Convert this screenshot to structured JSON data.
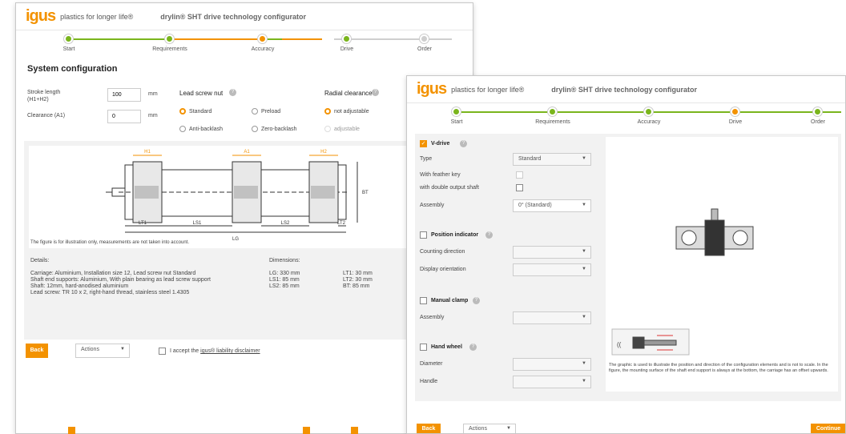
{
  "brand": {
    "logo": "igus",
    "tagline": "plastics for longer life®",
    "title": "drylin® SHT drive technology configurator"
  },
  "steps": [
    "Start",
    "Requirements",
    "Accuracy",
    "Drive",
    "Order"
  ],
  "w1": {
    "heading": "System configuration",
    "stroke_label": "Stroke length",
    "stroke_sub": "(H1+H2)",
    "stroke_value": "100",
    "clearance_label": "Clearance (A1)",
    "clearance_value": "0",
    "unit": "mm",
    "nut_label": "Lead screw nut",
    "nut_options": [
      "Standard",
      "Preload",
      "Anti-backlash",
      "Zero-backlash"
    ],
    "radial_label": "Radial clearance",
    "radial_options": [
      "not adjustable",
      "adjustable"
    ],
    "drawing": {
      "H1": "H1",
      "A1": "A1",
      "H2": "H2",
      "LT1": "LT1",
      "LS1": "LS1",
      "LS2": "LS2",
      "LT2": "LT2",
      "LG": "LG",
      "BT": "BT"
    },
    "figure_note": "The figure is for illustration only, measurements are not taken into account.",
    "details_label": "Details:",
    "details": [
      "Carriage: Aluminium, Installation size 12, Lead screw nut Standard",
      "Shaft end supports: Aluminium, With plain bearing as lead screw support",
      "Shaft: 12mm, hard-anodised aluminium",
      "Lead screw: TR 10 x 2, right-hand thread, stainless steel 1.4305"
    ],
    "dimensions_label": "Dimensions:",
    "dims_left": [
      "LG:   330 mm",
      "LS1:   85 mm",
      "LS2:   85 mm"
    ],
    "dims_right": [
      "LT1:   30 mm",
      "LT2:   30 mm",
      "BT:   85 mm"
    ],
    "back": "Back",
    "actions": "Actions",
    "accept_prefix": "I accept the ",
    "accept_link": "igus® liability disclaimer"
  },
  "w2": {
    "vdrive": "V-drive",
    "type_label": "Type",
    "type_value": "Standard",
    "feather_label": "With feather key",
    "double_label": "with double output shaft",
    "assembly_label": "Assembly",
    "assembly_value": "0° (Standard)",
    "pos_label": "Position indicator",
    "counting_label": "Counting direction",
    "display_label": "Display orientation",
    "clamp_label": "Manual clamp",
    "clamp_assembly_label": "Assembly",
    "wheel_label": "Hand wheel",
    "diameter_label": "Diameter",
    "handle_label": "Handle",
    "graphic_note": "The graphic is used to illustrate the position and direction of the configuration elements and is not to scale. In the figure, the mounting surface of the shaft end support is always at the bottom, the carriage has an offset upwards.",
    "back": "Back",
    "actions": "Actions",
    "continue": "Continue"
  },
  "colors": {
    "accent": "#f39200",
    "done": "#7ab51d"
  }
}
